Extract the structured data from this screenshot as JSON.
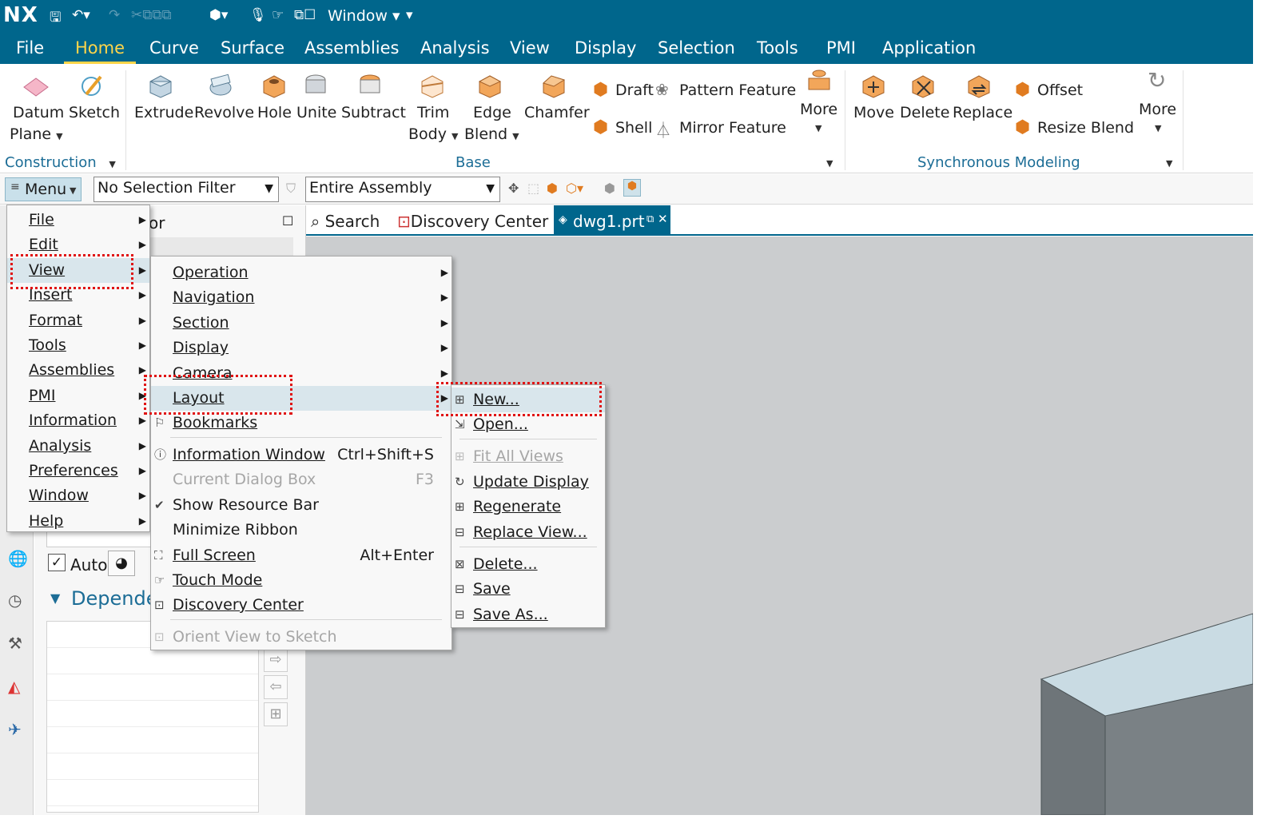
{
  "app": {
    "logo": "NX",
    "window_label": "Window"
  },
  "menubar": [
    "File",
    "Home",
    "Curve",
    "Surface",
    "Assemblies",
    "Analysis",
    "View",
    "Display",
    "Selection",
    "Tools",
    "PMI",
    "Application"
  ],
  "ribbon": {
    "construction": {
      "datum_plane_1": "Datum",
      "datum_plane_2": "Plane",
      "sketch": "Sketch",
      "group": "Construction"
    },
    "base": {
      "extrude": "Extrude",
      "revolve": "Revolve",
      "hole": "Hole",
      "unite": "Unite",
      "subtract": "Subtract",
      "trim_body_1": "Trim",
      "trim_body_2": "Body",
      "edge_blend_1": "Edge",
      "edge_blend_2": "Blend",
      "chamfer": "Chamfer",
      "draft": "Draft",
      "shell": "Shell",
      "pattern_feature": "Pattern Feature",
      "mirror_feature": "Mirror Feature",
      "more": "More",
      "group": "Base"
    },
    "sync": {
      "move": "Move",
      "delete": "Delete",
      "replace": "Replace",
      "offset": "Offset",
      "resize_blend": "Resize Blend",
      "more": "More",
      "group": "Synchronous Modeling"
    }
  },
  "selection_bar": {
    "menu_button": "Menu",
    "filter": "No Selection Filter",
    "scope": "Entire Assembly"
  },
  "nav_panel": {
    "title_fragment": "or",
    "auto_label": "Auto",
    "section": "Depende"
  },
  "tabs": {
    "search": "Search",
    "discovery": "Discovery Center",
    "active": "dwg1.prt"
  },
  "menu_l1": [
    "File",
    "Edit",
    "View",
    "Insert",
    "Format",
    "Tools",
    "Assemblies",
    "PMI",
    "Information",
    "Analysis",
    "Preferences",
    "Window",
    "Help"
  ],
  "menu_view": {
    "operation": "Operation",
    "navigation": "Navigation",
    "section": "Section",
    "display": "Display",
    "camera": "Camera",
    "layout": "Layout",
    "bookmarks": "Bookmarks",
    "information_window": "Information Window",
    "information_window_acc": "Ctrl+Shift+S",
    "current_dialog_box": "Current Dialog Box",
    "current_dialog_box_acc": "F3",
    "show_resource_bar": "Show Resource Bar",
    "minimize_ribbon": "Minimize Ribbon",
    "full_screen": "Full Screen",
    "full_screen_acc": "Alt+Enter",
    "touch_mode": "Touch Mode",
    "discovery_center": "Discovery Center",
    "orient_view": "Orient View to Sketch"
  },
  "menu_layout": {
    "new": "New...",
    "open": "Open...",
    "fit_all_views": "Fit All Views",
    "update_display": "Update Display",
    "regenerate": "Regenerate",
    "replace_view": "Replace View...",
    "delete": "Delete...",
    "save": "Save",
    "save_as": "Save As..."
  },
  "colors": {
    "title_bar": "#00668c",
    "active_tab_text": "#ffd54a",
    "highlight": "#d9e6ec",
    "annotation": "#e01212",
    "viewport": "#cbcdcf",
    "model_top": "#c9dbe3",
    "model_side": "#7a8185"
  }
}
